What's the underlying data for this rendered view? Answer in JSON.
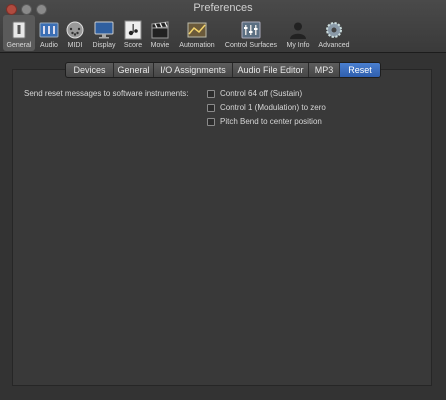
{
  "window": {
    "title": "Preferences"
  },
  "toolbar": {
    "items": [
      {
        "label": "General",
        "icon": "general-switch-icon"
      },
      {
        "label": "Audio",
        "icon": "audio-mixer-icon"
      },
      {
        "label": "MIDI",
        "icon": "midi-connector-icon"
      },
      {
        "label": "Display",
        "icon": "display-monitor-icon"
      },
      {
        "label": "Score",
        "icon": "score-notation-icon"
      },
      {
        "label": "Movie",
        "icon": "movie-clapper-icon"
      },
      {
        "label": "Automation",
        "icon": "automation-curve-icon"
      },
      {
        "label": "Control Surfaces",
        "icon": "control-surfaces-faders-icon"
      },
      {
        "label": "My Info",
        "icon": "user-silhouette-icon"
      },
      {
        "label": "Advanced",
        "icon": "gear-icon"
      }
    ],
    "selected": "General"
  },
  "tabs": [
    "Devices",
    "General",
    "I/O Assignments",
    "Audio File Editor",
    "MP3",
    "Reset"
  ],
  "active_tab": "Reset",
  "reset": {
    "description": "Send reset messages to software instruments:",
    "options": [
      {
        "label": "Control 64 off (Sustain)",
        "checked": false
      },
      {
        "label": "Control 1 (Modulation) to zero",
        "checked": false
      },
      {
        "label": "Pitch Bend to center position",
        "checked": false
      }
    ]
  },
  "colors": {
    "accent": "#3a6bc0",
    "background": "#333333"
  }
}
